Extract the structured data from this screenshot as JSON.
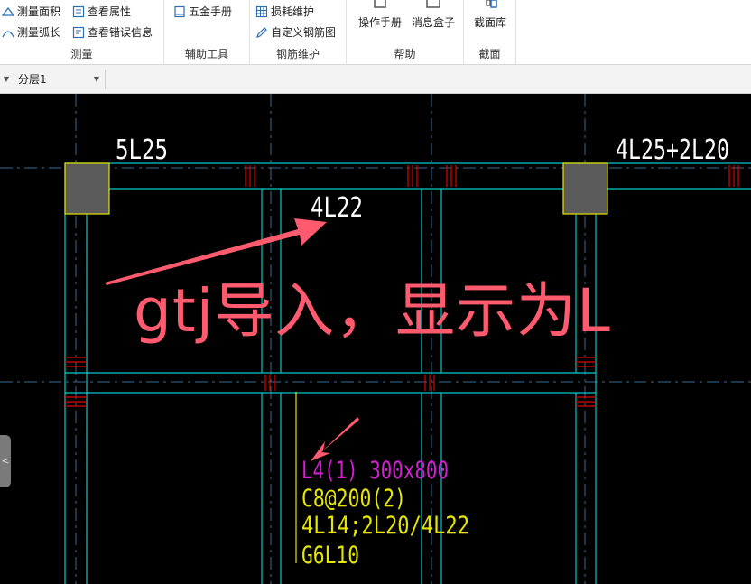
{
  "ribbon": {
    "groups": [
      {
        "label": "测量",
        "items": [
          "测量面积",
          "测量弧长",
          "查看属性",
          "查看错误信息"
        ]
      },
      {
        "label": "辅助工具",
        "items": [
          "五金手册"
        ]
      },
      {
        "label": "钢筋维护",
        "items": [
          "损耗维护",
          "自定义钢筋图"
        ]
      },
      {
        "label": "帮助",
        "items": [
          "操作手册",
          "消息盒子"
        ]
      },
      {
        "label": "截面",
        "items": [
          "截面库"
        ]
      }
    ]
  },
  "layer": {
    "selected": "分层1"
  },
  "canvas": {
    "labels": {
      "top_left_rebar": "5L25",
      "top_right_rebar": "4L25+2L20",
      "mid_rebar": "4L22"
    },
    "beam_annotation": {
      "name": "L4(1) 300x800",
      "stirrup": "C8@200(2)",
      "main_rebar": "4L14;2L20/4L22",
      "side_rebar": "G6L10"
    },
    "overlay_text": "gtj导入，显示为L",
    "side_tab_glyph": "<"
  },
  "colors": {
    "canvas_bg": "#000000",
    "axis_line": "#3a6a8f",
    "beam_line": "#00c8c8",
    "column_fill": "#5a5a5a",
    "column_edge": "#e6e600",
    "rebar_red": "#e00000",
    "annotation_red": "#ff5a6e",
    "magenta_text": "#d020d0",
    "yellow_text": "#e6e600",
    "white_text": "#ffffff"
  }
}
